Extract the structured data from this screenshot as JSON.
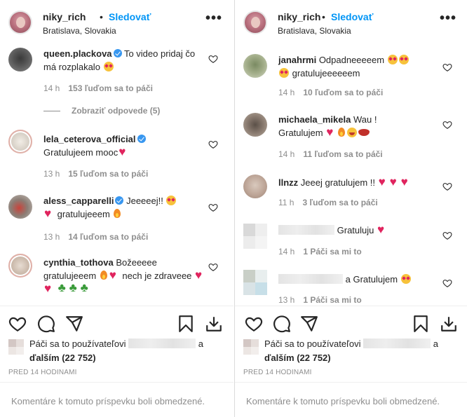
{
  "panels": [
    {
      "header": {
        "username": "niky_rich",
        "separator": "•",
        "follow_label": "Sledovať",
        "location": "Bratislava, Slovakia",
        "more": "•••"
      },
      "comments": [
        {
          "user": "queen.plackova",
          "verified": true,
          "text": "To video pridaj čo má rozplakalo",
          "time": "14 h",
          "likes": "153 ľuďom sa to páči",
          "replies": "Zobraziť odpovede (5)"
        },
        {
          "user": "lela_ceterova_official",
          "verified": true,
          "text": "Gratulujeem mooc",
          "time": "13 h",
          "likes": "15 ľuďom sa to páči"
        },
        {
          "user": "aless_capparelli",
          "verified": true,
          "text": "Jeeeeej!!",
          "text2": "gratulujeeem",
          "time": "13 h",
          "likes": "14 ľuďom sa to páči"
        },
        {
          "user": "cynthia_tothova",
          "verified": false,
          "text": "Božeeeee gratulujeeem",
          "text2": "nech je zdraveee",
          "time": "",
          "likes": ""
        }
      ],
      "likes": {
        "prefix": "Páči sa to používateľovi",
        "suffix": "a",
        "others": "ďalším (22 752)"
      },
      "time_ago": "PRED 14 HODINAMI",
      "closed_text": "Komentáre k tomuto príspevku boli obmedzené."
    },
    {
      "header": {
        "username": "niky_rich",
        "separator": "•",
        "follow_label": "Sledovať",
        "location": "Bratislava, Slovakia",
        "more": "•••"
      },
      "comments": [
        {
          "user": "janahrmi",
          "text": "Odpadneeeeem",
          "text2": "gratulujeeeeeem",
          "time": "14 h",
          "likes": "10 ľuďom sa to páči"
        },
        {
          "user": "michaela_mikela",
          "text": "Wau !",
          "text2": "Gratulujem",
          "time": "14 h",
          "likes": "11 ľuďom sa to páči"
        },
        {
          "user": "llnzz",
          "text": "Jeeej gratulujem !!",
          "time": "11 h",
          "likes": "3 ľuďom sa to páči"
        },
        {
          "user": "",
          "text": "Gratuluju",
          "time": "14 h",
          "likes": "1 Páči sa mi to"
        },
        {
          "user": "",
          "text": "a Gratulujem",
          "time": "13 h",
          "likes": "1 Páči sa mi to"
        }
      ],
      "likes": {
        "prefix": "Páči sa to používateľovi",
        "suffix": "a",
        "others": "ďalším (22 752)"
      },
      "time_ago": "PRED 14 HODINAMI",
      "closed_text": "Komentáre k tomuto príspevku boli obmedzené."
    }
  ],
  "icons": {
    "like": "heart-icon",
    "comment": "comment-icon",
    "share": "share-icon",
    "save": "bookmark-icon",
    "download": "download-icon"
  },
  "colors": {
    "link": "#0095f6",
    "verified": "#3897f0",
    "muted": "#8e8e8e",
    "text": "#262626"
  }
}
